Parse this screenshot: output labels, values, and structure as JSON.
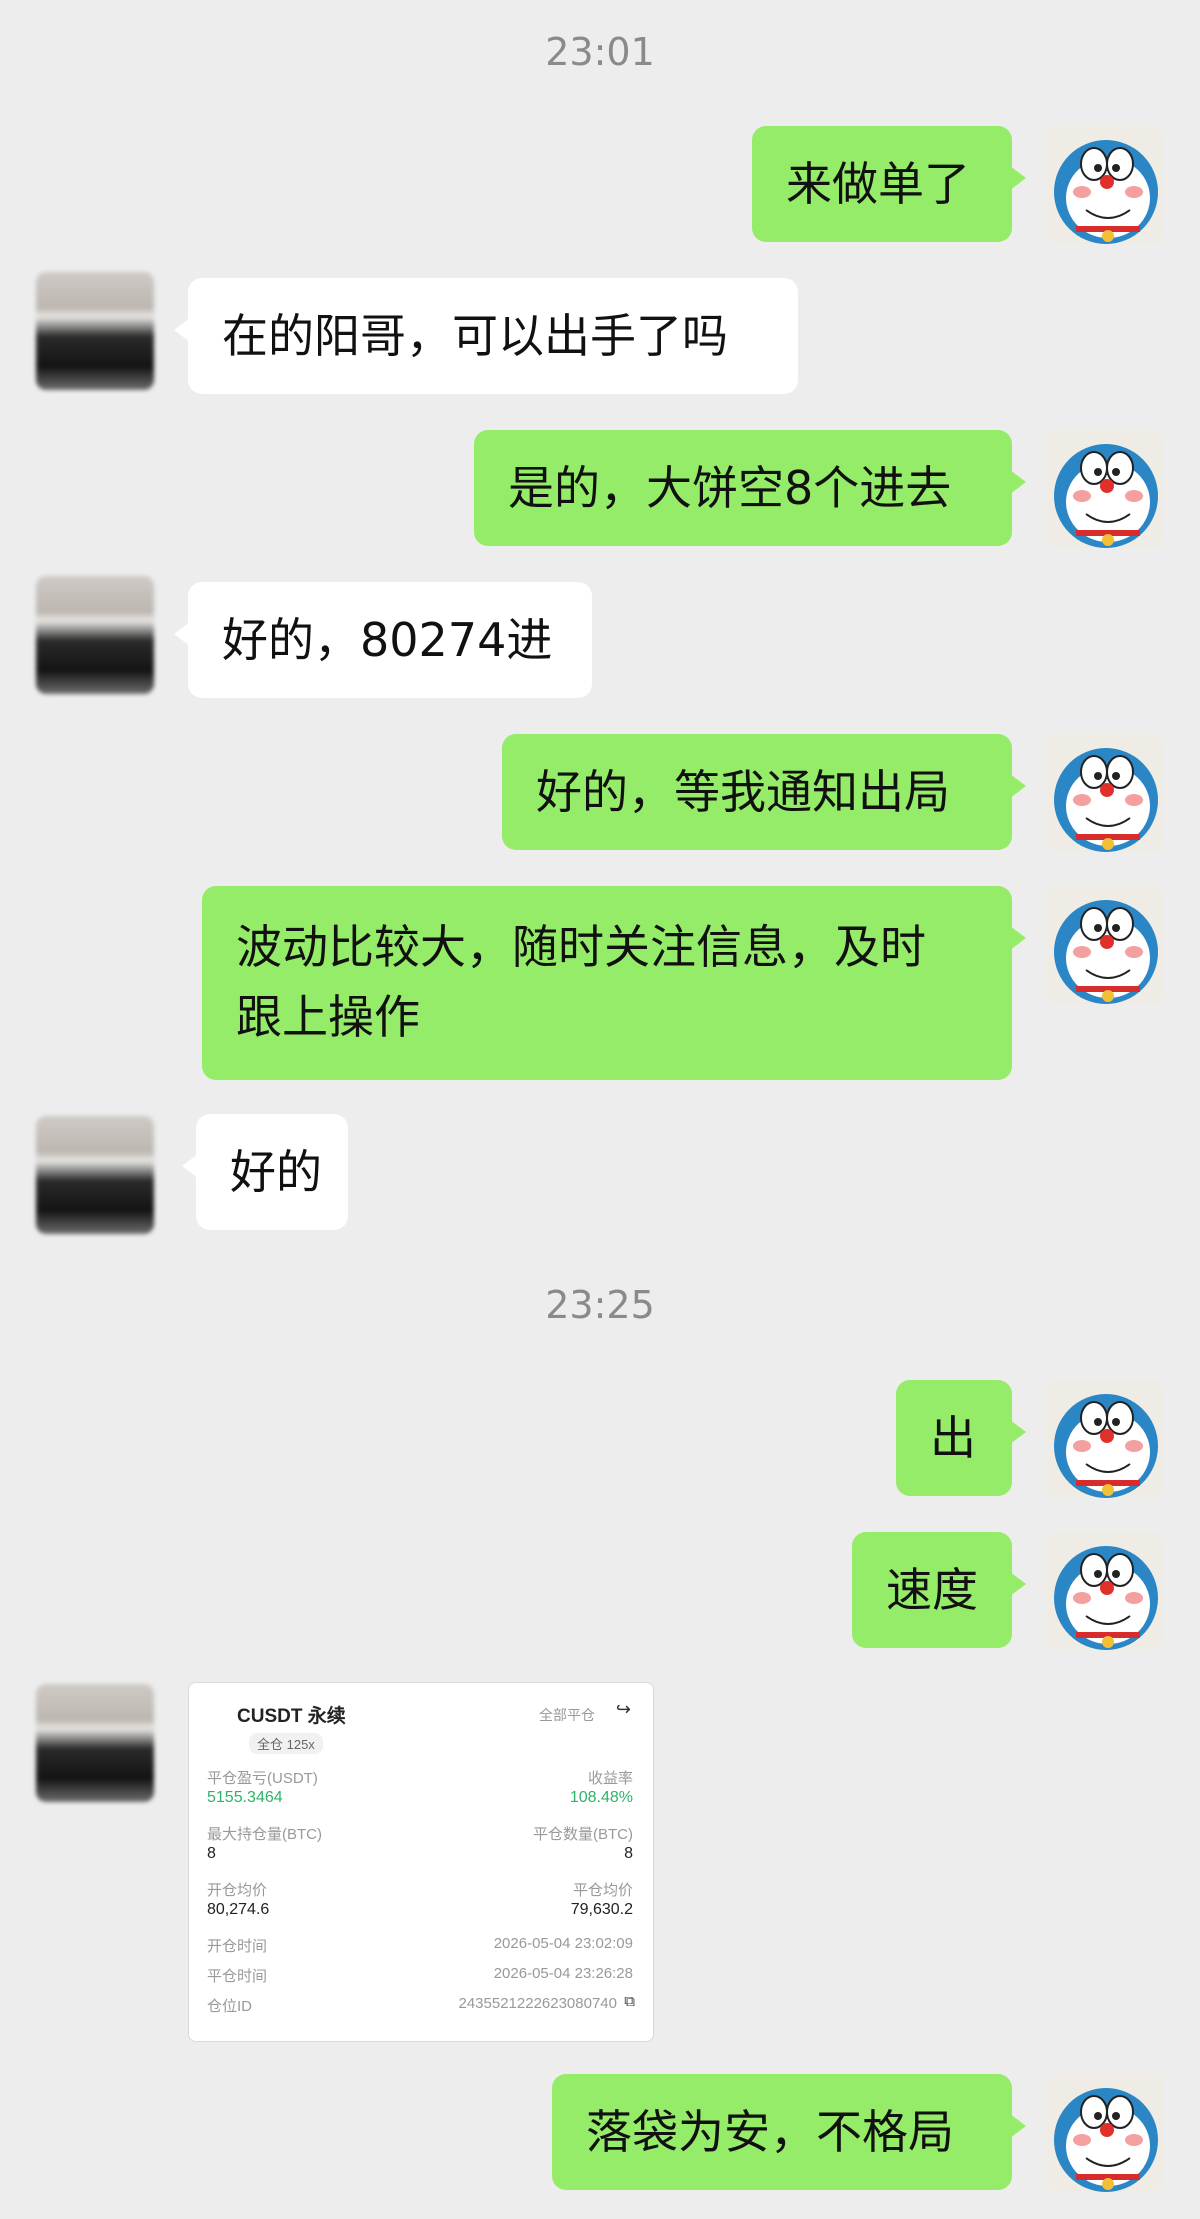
{
  "timestamps": [
    "23:01",
    "23:25"
  ],
  "messages": [
    {
      "from": "me",
      "text": "来做单了"
    },
    {
      "from": "them",
      "text": "在的阳哥，可以出手了吗"
    },
    {
      "from": "me",
      "text": "是的，大饼空8个进去"
    },
    {
      "from": "them",
      "text": "好的，80274进"
    },
    {
      "from": "me",
      "text": "好的，等我通知出局"
    },
    {
      "from": "me",
      "text_line1": "波动比较大，随时关注信息，及时",
      "text_line2": "跟上操作"
    },
    {
      "from": "them",
      "text": "好的"
    },
    {
      "from": "me",
      "text": "出"
    },
    {
      "from": "me",
      "text": "速度"
    },
    {
      "from": "me",
      "text": "落袋为安，不格局"
    }
  ],
  "trade_card": {
    "symbol": "CUSDT 永续",
    "mode": "全仓 125x",
    "action": "全部平仓",
    "pnl_label": "平仓盈亏(USDT)",
    "pnl_value": "5155.3464",
    "roi_label": "收益率",
    "roi_value": "108.48%",
    "max_pos_label": "最大持仓量(BTC)",
    "max_pos_value": "8",
    "close_qty_label": "平仓数量(BTC)",
    "close_qty_value": "8",
    "open_avg_label": "开仓均价",
    "open_avg_value": "80,274.6",
    "close_avg_label": "平仓均价",
    "close_avg_value": "79,630.2",
    "open_time_label": "开仓时间",
    "open_time_value": "2026-05-04 23:02:09",
    "close_time_label": "平仓时间",
    "close_time_value": "2026-05-04 23:26:28",
    "pos_id_label": "仓位ID",
    "pos_id_value": "2435521222623080740"
  },
  "colors": {
    "my_bubble": "#95ec69",
    "their_bubble": "#ffffff",
    "background": "#ededed",
    "profit": "#2db36a"
  }
}
